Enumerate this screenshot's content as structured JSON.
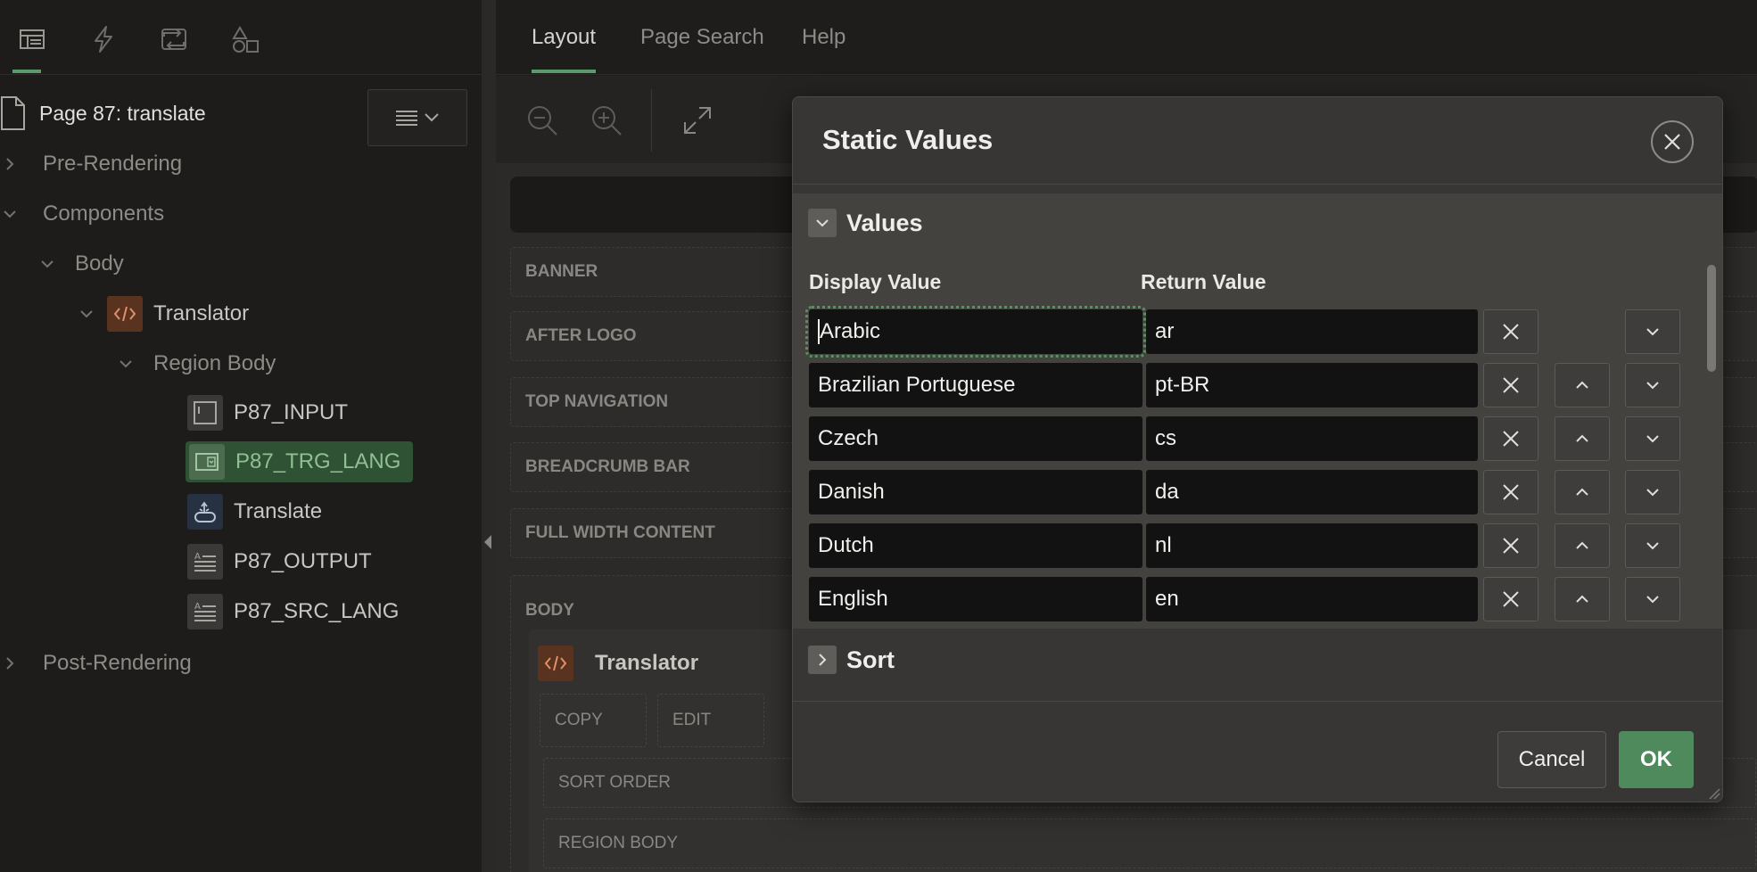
{
  "left_panel": {
    "toolbar_icons": [
      "rendering-tree-icon",
      "dynamic-actions-icon",
      "processing-icon",
      "shared-components-icon"
    ],
    "page_title": "Page 87: translate",
    "tree": {
      "pre_rendering": "Pre-Rendering",
      "components": "Components",
      "body": "Body",
      "translator": "Translator",
      "region_body": "Region Body",
      "items": [
        "P87_INPUT",
        "P87_TRG_LANG",
        "Translate",
        "P87_OUTPUT",
        "P87_SRC_LANG"
      ],
      "post_rendering": "Post-Rendering"
    }
  },
  "right_panel": {
    "tabs": [
      "Layout",
      "Page Search",
      "Help"
    ],
    "slots": [
      "BANNER",
      "AFTER LOGO",
      "TOP NAVIGATION",
      "BREADCRUMB BAR",
      "FULL WIDTH CONTENT"
    ],
    "body_label": "BODY",
    "region_title": "Translator",
    "region_buttons": [
      "COPY",
      "EDIT"
    ],
    "region_rows": [
      "SORT ORDER",
      "REGION BODY"
    ]
  },
  "modal": {
    "title": "Static Values",
    "values_section": "Values",
    "col_display": "Display Value",
    "col_return": "Return Value",
    "rows": [
      {
        "display": "Arabic",
        "return": "ar"
      },
      {
        "display": "Brazilian Portuguese",
        "return": "pt-BR"
      },
      {
        "display": "Czech",
        "return": "cs"
      },
      {
        "display": "Danish",
        "return": "da"
      },
      {
        "display": "Dutch",
        "return": "nl"
      },
      {
        "display": "English",
        "return": "en"
      }
    ],
    "sort_section": "Sort",
    "cancel_label": "Cancel",
    "ok_label": "OK"
  },
  "colors": {
    "accent_green": "#5b9a6a",
    "ok_button": "#4f8a5c",
    "selected_node": "#2f5234",
    "region_icon": "#5a3320"
  }
}
